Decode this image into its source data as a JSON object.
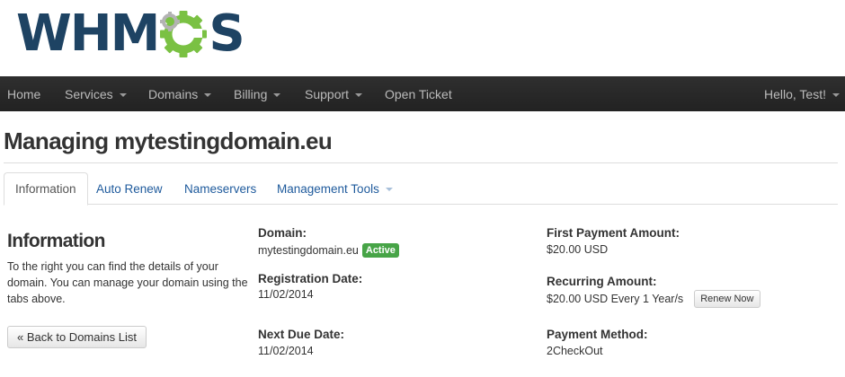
{
  "logo": {
    "text_left": "WHM",
    "text_right": "S"
  },
  "nav": {
    "home": "Home",
    "services": "Services",
    "domains": "Domains",
    "billing": "Billing",
    "support": "Support",
    "open_ticket": "Open Ticket",
    "user": "Hello, Test!"
  },
  "page": {
    "title": "Managing mytestingdomain.eu"
  },
  "tabs": {
    "information": "Information",
    "auto_renew": "Auto Renew",
    "nameservers": "Nameservers",
    "management_tools": "Management Tools"
  },
  "info": {
    "heading": "Information",
    "description": "To the right you can find the details of your domain. You can manage your domain using the tabs above.",
    "back_button": "« Back to Domains List"
  },
  "details": {
    "domain_label": "Domain:",
    "domain_value": "mytestingdomain.eu",
    "status": "Active",
    "registration_label": "Registration Date:",
    "registration_value": "11/02/2014",
    "next_due_label": "Next Due Date:",
    "next_due_value": "11/02/2014",
    "first_payment_label": "First Payment Amount:",
    "first_payment_value": "$20.00 USD",
    "recurring_label": "Recurring Amount:",
    "recurring_value": "$20.00 USD Every 1 Year/s",
    "renew_button": "Renew Now",
    "payment_method_label": "Payment Method:",
    "payment_method_value": "2CheckOut"
  },
  "colors": {
    "brand_dark": "#1e4363",
    "brand_green": "#7ac143",
    "navbar": "#222222",
    "link": "#1e5a9c",
    "status_active": "#47a447"
  }
}
